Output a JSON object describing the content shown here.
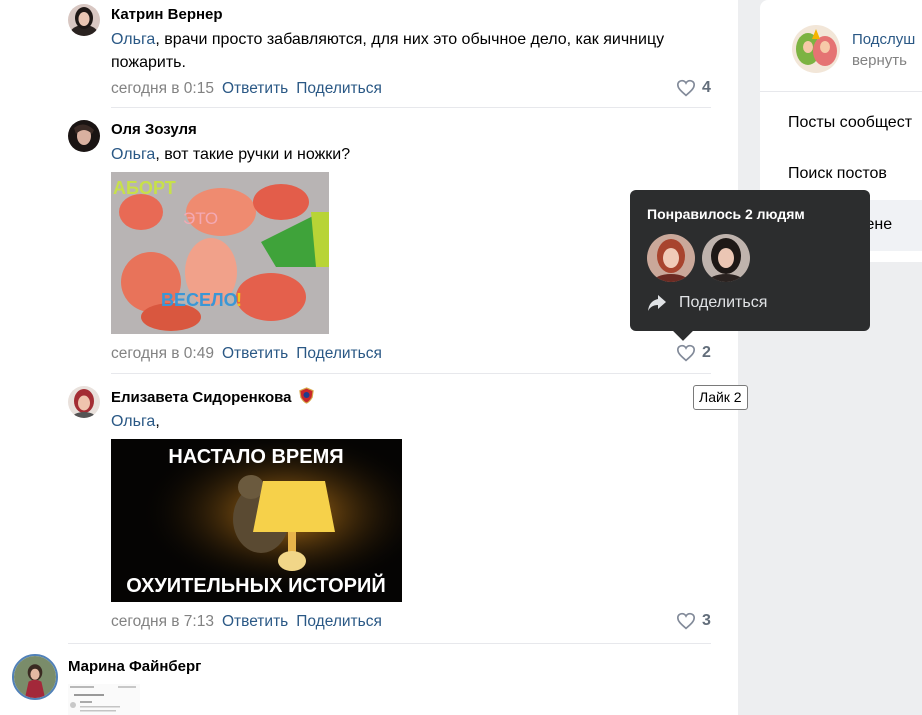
{
  "comments": [
    {
      "author": "Катрин Вернер",
      "mention": "Ольга",
      "text": ", врачи просто забавляются, для них это обычное дело, как яичницу пожарить.",
      "time": "сегодня в 0:15",
      "reply": "Ответить",
      "share": "Поделиться",
      "likes": "4"
    },
    {
      "author": "Оля Зозуля",
      "mention": "Ольга",
      "text": ", вот такие ручки и ножки?",
      "time": "сегодня в 0:49",
      "reply": "Ответить",
      "share": "Поделиться",
      "likes": "2",
      "image_text": [
        "АБОРТ",
        "ЭТО",
        "ВЕСЕЛО",
        "!"
      ]
    },
    {
      "author": "Елизавета Сидоренкова",
      "mention": "Ольга",
      "text": ",",
      "time": "сегодня в 7:13",
      "reply": "Ответить",
      "share": "Поделиться",
      "likes": "3",
      "image_text": [
        "НАСТАЛО ВРЕМЯ",
        "ОХУИТЕЛЬНЫХ ИСТОРИЙ"
      ]
    },
    {
      "author": "Марина Файнберг"
    }
  ],
  "sidebar": {
    "community_link": "Подслуш",
    "back_link": "вернуть",
    "items": [
      "Посты сообщест",
      "Поиск постов",
      "Пост на стене"
    ]
  },
  "tooltip": {
    "title": "Понравилось 2 людям",
    "share": "Поделиться"
  },
  "hint": "Лайк 2",
  "colors": {
    "link": "#2a5885",
    "meta": "#828282",
    "tooltip_bg": "#2c2d2e"
  }
}
